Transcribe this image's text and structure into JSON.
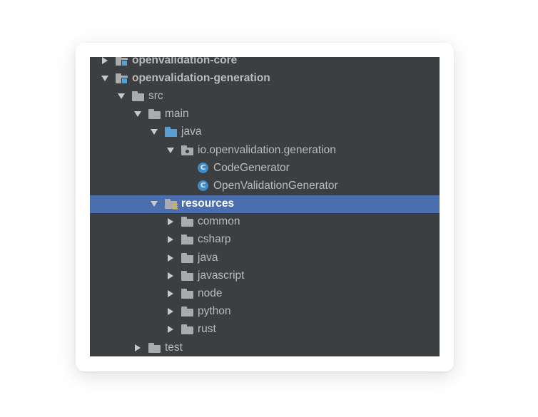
{
  "project_tree": {
    "items": [
      {
        "label": "openvalidation-core",
        "depth": 0,
        "state": "collapsed",
        "icon": "module-folder-icon",
        "bold": true
      },
      {
        "label": "openvalidation-generation",
        "depth": 0,
        "state": "expanded",
        "icon": "module-folder-icon",
        "bold": true
      },
      {
        "label": "src",
        "depth": 1,
        "state": "expanded",
        "icon": "folder-icon"
      },
      {
        "label": "main",
        "depth": 2,
        "state": "expanded",
        "icon": "folder-icon"
      },
      {
        "label": "java",
        "depth": 3,
        "state": "expanded",
        "icon": "source-folder-icon"
      },
      {
        "label": "io.openvalidation.generation",
        "depth": 4,
        "state": "expanded",
        "icon": "package-icon"
      },
      {
        "label": "CodeGenerator",
        "depth": 5,
        "state": "none",
        "icon": "class-icon"
      },
      {
        "label": "OpenValidationGenerator",
        "depth": 5,
        "state": "none",
        "icon": "class-icon"
      },
      {
        "label": "resources",
        "depth": 3,
        "state": "expanded",
        "icon": "resources-folder-icon",
        "selected": true,
        "bold": true
      },
      {
        "label": "common",
        "depth": 4,
        "state": "collapsed",
        "icon": "folder-icon"
      },
      {
        "label": "csharp",
        "depth": 4,
        "state": "collapsed",
        "icon": "folder-icon"
      },
      {
        "label": "java",
        "depth": 4,
        "state": "collapsed",
        "icon": "folder-icon"
      },
      {
        "label": "javascript",
        "depth": 4,
        "state": "collapsed",
        "icon": "folder-icon"
      },
      {
        "label": "node",
        "depth": 4,
        "state": "collapsed",
        "icon": "folder-icon"
      },
      {
        "label": "python",
        "depth": 4,
        "state": "collapsed",
        "icon": "folder-icon"
      },
      {
        "label": "rust",
        "depth": 4,
        "state": "collapsed",
        "icon": "folder-icon"
      },
      {
        "label": "test",
        "depth": 2,
        "state": "collapsed",
        "icon": "folder-icon"
      }
    ],
    "class_icon_glyph": "C"
  },
  "colors": {
    "panel_background": "#3c3f41",
    "selection": "#4b6eaf",
    "text": "#bbbbbb",
    "folder": "#a9acae",
    "source_folder": "#5a9fd4",
    "class_badge": "#3d8bc7"
  }
}
